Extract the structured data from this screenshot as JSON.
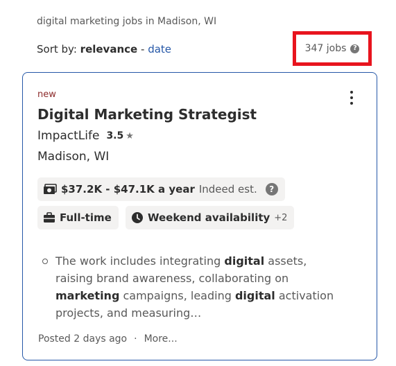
{
  "search_context": "digital marketing jobs in Madison, WI",
  "sort": {
    "label": "Sort by:",
    "relevance": "relevance",
    "separator": "-",
    "date": "date"
  },
  "job_count": {
    "text": "347 jobs",
    "help_glyph": "?",
    "highlight_color": "#e8141e"
  },
  "job": {
    "tag": "new",
    "title": "Digital Marketing Strategist",
    "company": "ImpactLife",
    "rating": "3.5",
    "star": "★",
    "location": "Madison, WI",
    "salary": "$37.2K - $47.1K a year",
    "salary_note": "Indeed est.",
    "salary_help": "?",
    "job_type": "Full-time",
    "schedule": "Weekend availability",
    "schedule_more": "+2",
    "snippet": {
      "p1": "The work includes integrating ",
      "b1": "digital",
      "p2": " assets, raising brand awareness, collaborating on ",
      "b2": "marketing",
      "p3": " campaigns, leading ",
      "b3": "digital",
      "p4": " activation projects, and measuring…"
    },
    "posted": "Posted 2 days ago",
    "dot": "·",
    "more": "More..."
  },
  "icons": {
    "salary": "money-icon",
    "job_type": "briefcase-icon",
    "schedule": "clock-icon",
    "menu": "kebab-menu-icon"
  },
  "colors": {
    "link": "#2557a7",
    "card_border": "#2557a7",
    "new_tag": "#8c2a2a",
    "chip_bg": "#f3f2f1"
  }
}
